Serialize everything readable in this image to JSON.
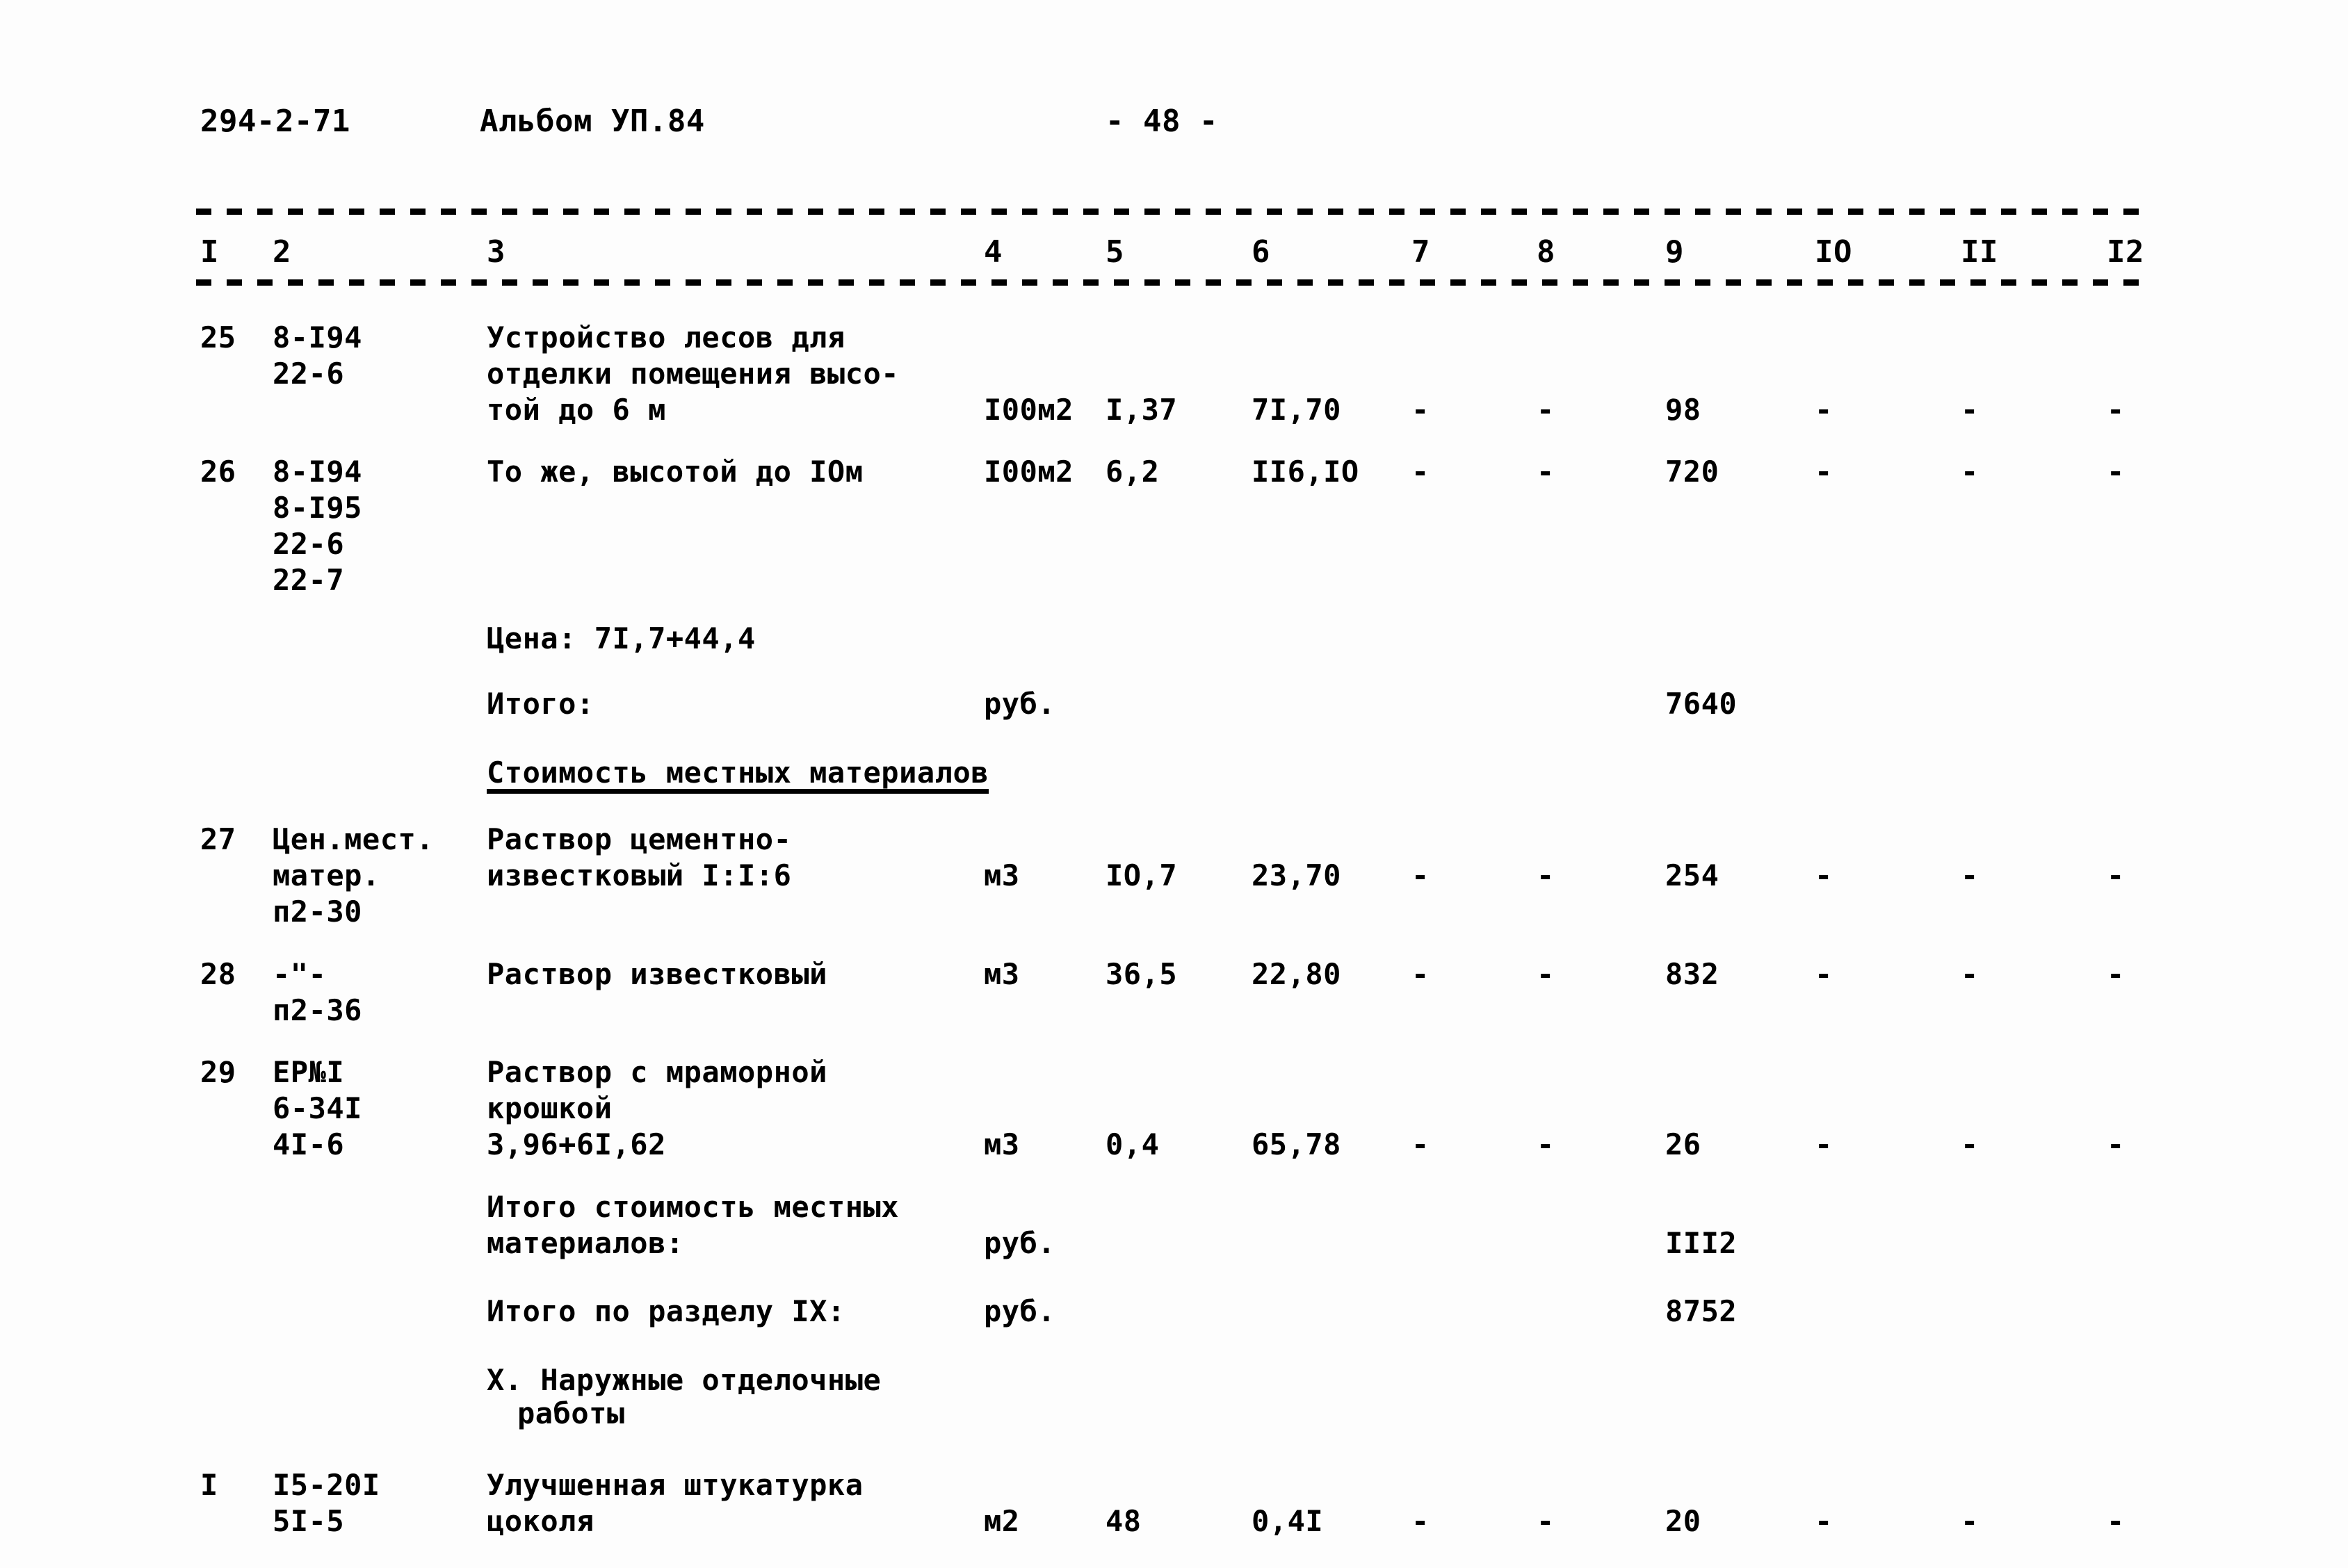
{
  "header": {
    "doc_code": "294-2-71",
    "album": "Альбом УП.84",
    "page_marker": "- 48 -"
  },
  "table": {
    "column_numbers": [
      "I",
      "2",
      "3",
      "4",
      "5",
      "6",
      "7",
      "8",
      "9",
      "IO",
      "II",
      "I2"
    ],
    "rows": [
      {
        "kind": "item",
        "num": "25",
        "code_lines": [
          "8-I94",
          "22-6"
        ],
        "desc_lines": [
          "Устройство лесов для",
          "отделки помещения высо-",
          "той до 6 м"
        ],
        "unit": "I00м2",
        "qty": "I,37",
        "price": "7I,70",
        "c7": "-",
        "c8": "-",
        "total": "98",
        "c10": "-",
        "c11": "-",
        "c12": "-"
      },
      {
        "kind": "item",
        "num": "26",
        "code_lines": [
          "8-I94",
          "8-I95",
          "22-6",
          "22-7"
        ],
        "desc_lines": [
          "То же, высотой до IOм"
        ],
        "note": "Цена: 7I,7+44,4",
        "unit": "I00м2",
        "qty": "6,2",
        "price": "II6,IO",
        "c7": "-",
        "c8": "-",
        "total": "720",
        "c10": "-",
        "c11": "-",
        "c12": "-"
      },
      {
        "kind": "total",
        "label": "Итого:",
        "unit": "руб.",
        "total": "7640"
      },
      {
        "kind": "section",
        "label": "Стоимость местных материалов"
      },
      {
        "kind": "item",
        "num": "27",
        "code_lines": [
          "Цен.мест.",
          "матер.",
          "п2-30"
        ],
        "desc_lines": [
          "Раствор цементно-",
          "известковый I:I:6"
        ],
        "unit": "м3",
        "qty": "IO,7",
        "price": "23,70",
        "c7": "-",
        "c8": "-",
        "total": "254",
        "c10": "-",
        "c11": "-",
        "c12": "-"
      },
      {
        "kind": "item",
        "num": "28",
        "code_lines": [
          "-\"-",
          "п2-36"
        ],
        "desc_lines": [
          "Раствор известковый"
        ],
        "unit": "м3",
        "qty": "36,5",
        "price": "22,80",
        "c7": "-",
        "c8": "-",
        "total": "832",
        "c10": "-",
        "c11": "-",
        "c12": "-"
      },
      {
        "kind": "item",
        "num": "29",
        "code_lines": [
          "ЕР№I",
          "6-34I",
          "4I-6"
        ],
        "desc_lines": [
          "Раствор с мраморной",
          "крошкой",
          "3,96+6I,62"
        ],
        "unit": "м3",
        "qty": "0,4",
        "price": "65,78",
        "c7": "-",
        "c8": "-",
        "total": "26",
        "c10": "-",
        "c11": "-",
        "c12": "-"
      },
      {
        "kind": "total",
        "label_lines": [
          "Итого стоимость местных",
          "материалов:"
        ],
        "unit": "руб.",
        "total": "III2"
      },
      {
        "kind": "total",
        "label": "Итого по разделу IX:",
        "unit": "руб.",
        "total": "8752"
      },
      {
        "kind": "chapter",
        "label_lines": [
          "X. Наружные отделочные",
          "работы"
        ]
      },
      {
        "kind": "item",
        "num": "I",
        "code_lines": [
          "I5-20I",
          "5I-5"
        ],
        "desc_lines": [
          "Улучшенная штукатурка",
          "цоколя"
        ],
        "unit": "м2",
        "qty": "48",
        "price": "0,4I",
        "c7": "-",
        "c8": "-",
        "total": "20",
        "c10": "-",
        "c11": "-",
        "c12": "-"
      }
    ]
  }
}
